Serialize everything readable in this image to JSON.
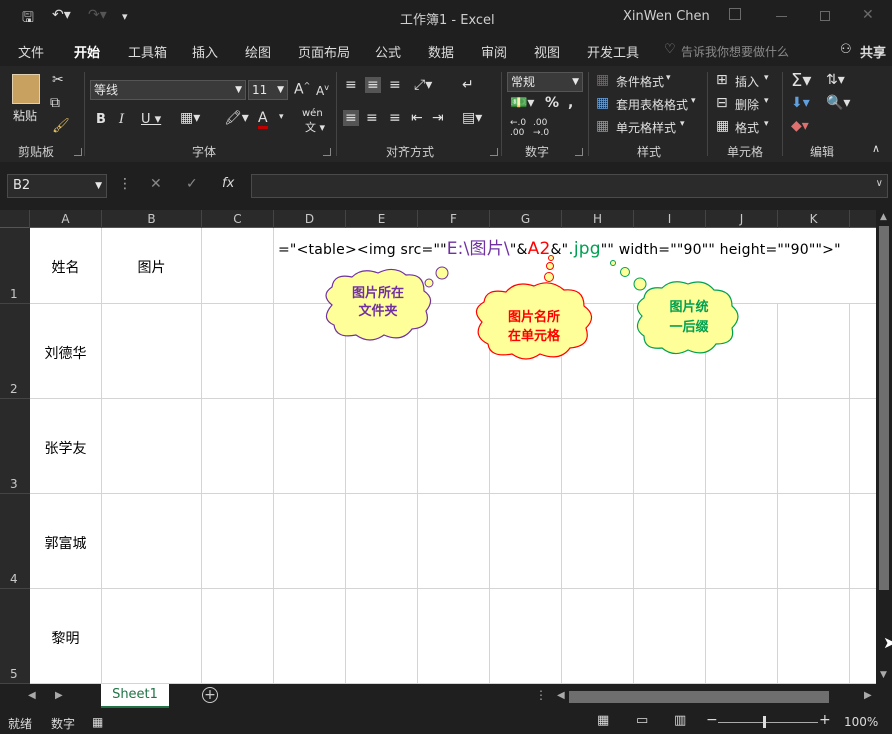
{
  "window": {
    "title": "工作簿1  -  Excel",
    "user": "XinWen Chen"
  },
  "menu": {
    "items": [
      "文件",
      "开始",
      "工具箱",
      "插入",
      "绘图",
      "页面布局",
      "公式",
      "数据",
      "审阅",
      "视图",
      "开发工具"
    ],
    "active": "开始",
    "tell_me": "告诉我你想要做什么",
    "share": "共享"
  },
  "ribbon": {
    "clipboard": {
      "paste": "粘贴",
      "label": "剪贴板"
    },
    "font": {
      "name": "等线",
      "size": "11",
      "label": "字体",
      "wen": "wén"
    },
    "alignment": {
      "label": "对齐方式"
    },
    "number": {
      "format": "常规",
      "label": "数字"
    },
    "styles": {
      "conditional": "条件格式",
      "table": "套用表格格式",
      "cell": "单元格样式",
      "label": "样式"
    },
    "cells": {
      "insert": "插入",
      "delete": "删除",
      "format": "格式",
      "label": "单元格"
    },
    "editing": {
      "label": "编辑"
    }
  },
  "formula_bar": {
    "name_box": "B2",
    "formula": ""
  },
  "grid": {
    "columns": [
      "A",
      "B",
      "C",
      "D",
      "E",
      "F",
      "G",
      "H",
      "I",
      "J",
      "K"
    ],
    "rows": [
      "1",
      "2",
      "3",
      "4",
      "5"
    ],
    "cells": {
      "A1": "姓名",
      "B1": "图片",
      "A2": "刘德华",
      "A3": "张学友",
      "A4": "郭富城",
      "A5": "黎明"
    },
    "formula_parts": {
      "p1": "=\"<table><img src=\"\"",
      "p2": "E:\\图片\\",
      "p3": "\"&",
      "p4": "A2",
      "p5": "&\"",
      "p6": ".jpg",
      "p7": "\"\" width=\"\"90\"\" height=\"\"90\"\">\""
    }
  },
  "callouts": {
    "folder": {
      "line1": "图片所在",
      "line2": "文件夹"
    },
    "name_cell": {
      "line1": "图片名所",
      "line2": "在单元格"
    },
    "suffix": {
      "line1": "图片统",
      "line2": "一后缀"
    }
  },
  "colors": {
    "folder_text": "#7030a0",
    "cell_ref": "#ff0000",
    "suffix_text": "#00a050",
    "cloud_fill": "#ffff99",
    "excel_green": "#217346"
  },
  "sheet_tabs": [
    "Sheet1"
  ],
  "status": {
    "ready": "就绪",
    "numlock": "数字",
    "zoom": "100%"
  }
}
